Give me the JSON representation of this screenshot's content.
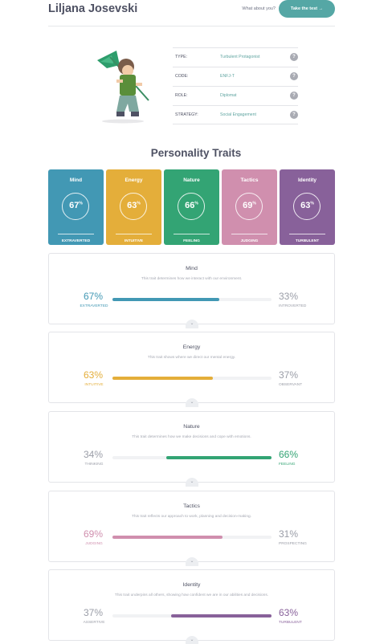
{
  "header": {
    "name": "Liljana Josevski",
    "what_about": "What about you?",
    "cta": "Take the test →"
  },
  "hero_image": "character-with-flag-illustration",
  "info": [
    {
      "label": "TYPE:",
      "value": "Turbulent Protagonist"
    },
    {
      "label": "CODE:",
      "value": "ENFJ-T"
    },
    {
      "label": "ROLE:",
      "value": "Diplomat"
    },
    {
      "label": "STRATEGY:",
      "value": "Social Engagement"
    }
  ],
  "section_title": "Personality Traits",
  "cards": [
    {
      "title": "Mind",
      "pct": "67",
      "label": "EXTRAVERTED",
      "color": "#4298b4"
    },
    {
      "title": "Energy",
      "pct": "63",
      "label": "INTUITIVE",
      "color": "#e4ae3a"
    },
    {
      "title": "Nature",
      "pct": "66",
      "label": "FEELING",
      "color": "#33a474"
    },
    {
      "title": "Tactics",
      "pct": "69",
      "label": "JUDGING",
      "color": "#d08fae"
    },
    {
      "title": "Identity",
      "pct": "63",
      "label": "TURBULENT",
      "color": "#88619a"
    }
  ],
  "traits": [
    {
      "title": "Mind",
      "desc": "This trait determines how we interact with our environment.",
      "left_pct": "67%",
      "left_label": "EXTRAVERTED",
      "right_pct": "33%",
      "right_label": "INTROVERTED",
      "dominant": "left",
      "value": 0.67,
      "color": "#4298b4"
    },
    {
      "title": "Energy",
      "desc": "This trait shows where we direct our mental energy.",
      "left_pct": "63%",
      "left_label": "INTUITIVE",
      "right_pct": "37%",
      "right_label": "OBSERVANT",
      "dominant": "left",
      "value": 0.63,
      "color": "#e4ae3a"
    },
    {
      "title": "Nature",
      "desc": "This trait determines how we make decisions and cope with emotions.",
      "left_pct": "34%",
      "left_label": "THINKING",
      "right_pct": "66%",
      "right_label": "FEELING",
      "dominant": "right",
      "value": 0.66,
      "color": "#33a474"
    },
    {
      "title": "Tactics",
      "desc": "This trait reflects our approach to work, planning and decision-making.",
      "left_pct": "69%",
      "left_label": "JUDGING",
      "right_pct": "31%",
      "right_label": "PROSPECTING",
      "dominant": "left",
      "value": 0.69,
      "color": "#d08fae"
    },
    {
      "title": "Identity",
      "desc": "This trait underpins all others, showing how confident we are in our abilities and decisions.",
      "left_pct": "37%",
      "left_label": "ASSERTIVE",
      "right_pct": "63%",
      "right_label": "TURBULENT",
      "dominant": "right",
      "value": 0.63,
      "color": "#88619a"
    }
  ]
}
